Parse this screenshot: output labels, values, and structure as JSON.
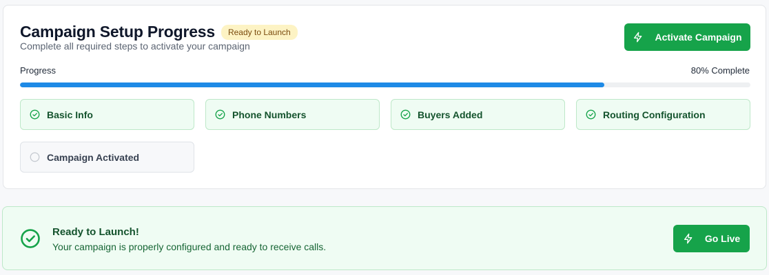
{
  "header": {
    "title": "Campaign Setup Progress",
    "badge": "Ready to Launch",
    "subtitle": "Complete all required steps to activate your campaign",
    "activate_label": "Activate Campaign"
  },
  "progress": {
    "label": "Progress",
    "percent_text": "80% Complete",
    "value": 0.8
  },
  "steps": [
    {
      "label": "Basic Info",
      "status": "done"
    },
    {
      "label": "Phone Numbers",
      "status": "done"
    },
    {
      "label": "Buyers Added",
      "status": "done"
    },
    {
      "label": "Routing Configuration",
      "status": "done"
    },
    {
      "label": "Campaign Activated",
      "status": "pending"
    }
  ],
  "banner": {
    "title": "Ready to Launch!",
    "text": "Your campaign is properly configured and ready to receive calls.",
    "button_label": "Go Live"
  },
  "colors": {
    "accent_green": "#16a34a",
    "progress_blue": "#1e8ae6",
    "badge_yellow": "#fdf3c4"
  }
}
